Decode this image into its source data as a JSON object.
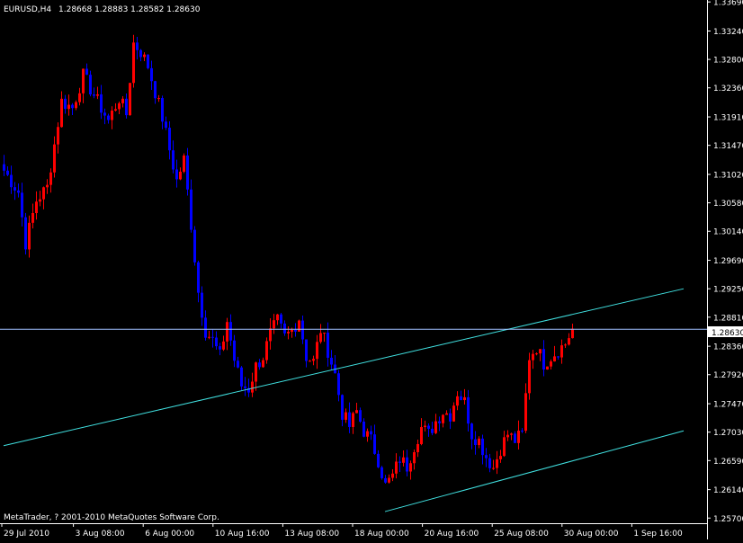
{
  "window": {
    "symbol_title": "EURUSD,H4",
    "ohlc_readout": "1.28668 1.28883 1.28582 1.28630",
    "copyright": "MetaTrader, ? 2001-2010 MetaQuotes Software Corp."
  },
  "colors": {
    "background": "#000000",
    "axis": "#ffffff",
    "bull_candle": "#ff0000",
    "bear_candle": "#0000ff",
    "trendline": "#40e0e0",
    "current_price_line": "#a0c0ff"
  },
  "chart_data": {
    "type": "candlestick",
    "symbol": "EURUSD",
    "timeframe": "H4",
    "current_price": 1.2863,
    "current_price_label": "1.28630",
    "ylim": [
      1.2562,
      1.3372
    ],
    "y_ticks": [
      "1.33690",
      "1.33240",
      "1.32800",
      "1.32360",
      "1.31910",
      "1.31470",
      "1.31020",
      "1.30580",
      "1.30140",
      "1.29690",
      "1.29250",
      "1.28810",
      "1.28360",
      "1.27920",
      "1.27470",
      "1.27030",
      "1.26590",
      "1.26140",
      "1.25700"
    ],
    "x_ticks": [
      "29 Jul 2010",
      "3 Aug 08:00",
      "6 Aug 00:00",
      "10 Aug 16:00",
      "13 Aug 08:00",
      "18 Aug 00:00",
      "20 Aug 16:00",
      "25 Aug 08:00",
      "30 Aug 00:00",
      "1 Sep 16:00"
    ],
    "waypoints": [
      [
        0,
        1.3108
      ],
      [
        4,
        1.3075
      ],
      [
        6,
        1.2996
      ],
      [
        9,
        1.3062
      ],
      [
        12,
        1.3082
      ],
      [
        16,
        1.3215
      ],
      [
        19,
        1.3205
      ],
      [
        22,
        1.3255
      ],
      [
        25,
        1.3225
      ],
      [
        29,
        1.3185
      ],
      [
        32,
        1.322
      ],
      [
        34,
        1.3195
      ],
      [
        36,
        1.3305
      ],
      [
        38,
        1.3292
      ],
      [
        40,
        1.327
      ],
      [
        42,
        1.323
      ],
      [
        44,
        1.319
      ],
      [
        46,
        1.314
      ],
      [
        48,
        1.3092
      ],
      [
        50,
        1.3125
      ],
      [
        52,
        1.3025
      ],
      [
        54,
        1.292
      ],
      [
        56,
        1.286
      ],
      [
        58,
        1.2845
      ],
      [
        60,
        1.282
      ],
      [
        62,
        1.2875
      ],
      [
        64,
        1.2815
      ],
      [
        66,
        1.2775
      ],
      [
        68,
        1.277
      ],
      [
        70,
        1.2805
      ],
      [
        72,
        1.282
      ],
      [
        74,
        1.2855
      ],
      [
        76,
        1.2875
      ],
      [
        78,
        1.285
      ],
      [
        80,
        1.286
      ],
      [
        82,
        1.288
      ],
      [
        84,
        1.282
      ],
      [
        86,
        1.2812
      ],
      [
        88,
        1.2862
      ],
      [
        90,
        1.283
      ],
      [
        92,
        1.2792
      ],
      [
        94,
        1.2732
      ],
      [
        96,
        1.2712
      ],
      [
        98,
        1.2735
      ],
      [
        100,
        1.2705
      ],
      [
        102,
        1.269
      ],
      [
        104,
        1.266
      ],
      [
        106,
        1.262
      ],
      [
        108,
        1.2635
      ],
      [
        110,
        1.2662
      ],
      [
        112,
        1.265
      ],
      [
        114,
        1.2682
      ],
      [
        116,
        1.271
      ],
      [
        118,
        1.27
      ],
      [
        120,
        1.272
      ],
      [
        122,
        1.2735
      ],
      [
        124,
        1.273
      ],
      [
        126,
        1.2765
      ],
      [
        128,
        1.275
      ],
      [
        130,
        1.27
      ],
      [
        132,
        1.269
      ],
      [
        134,
        1.2665
      ],
      [
        136,
        1.2648
      ],
      [
        138,
        1.2678
      ],
      [
        140,
        1.27
      ],
      [
        142,
        1.269
      ],
      [
        144,
        1.27
      ],
      [
        146,
        1.282
      ],
      [
        148,
        1.2835
      ],
      [
        150,
        1.281
      ],
      [
        152,
        1.282
      ],
      [
        154,
        1.283
      ],
      [
        156,
        1.284
      ],
      [
        158,
        1.2863
      ]
    ],
    "trendlines": [
      {
        "from": [
          0,
          1.2682
        ],
        "to": [
          189,
          1.2925
        ]
      },
      {
        "from": [
          106,
          1.258
        ],
        "to": [
          189,
          1.2705
        ]
      }
    ]
  }
}
